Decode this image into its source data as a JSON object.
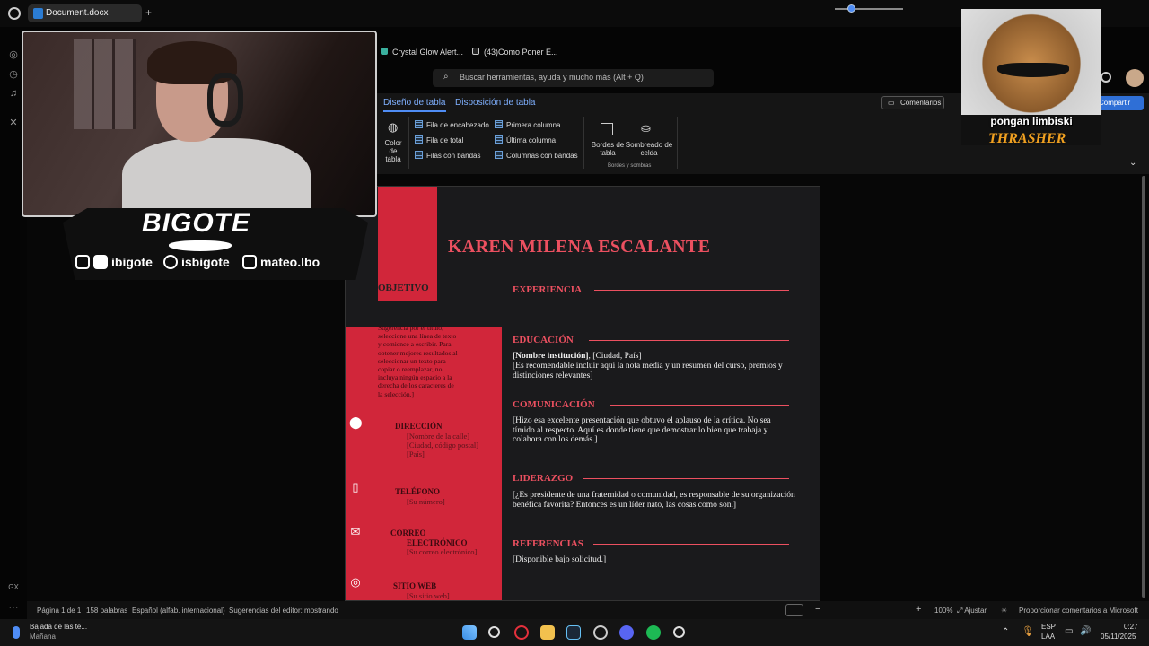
{
  "browser": {
    "tab_title": "Document.docx",
    "new_tab": "+",
    "bookmarks": [
      "Crystal Glow Alert...",
      "(43)Como Poner E..."
    ]
  },
  "word": {
    "search_placeholder": "Buscar herramientas, ayuda y mucho más (Alt + Q)",
    "ribbon_tabs": [
      "Diseño de tabla",
      "Disposición de tabla"
    ],
    "comments_button": "Comentarios",
    "share_button": "Compartir",
    "ribbon": {
      "color_tabla_1": "Color de",
      "color_tabla_2": "tabla",
      "options_col1": [
        "Fila de encabezado",
        "Fila de total",
        "Filas con bandas"
      ],
      "options_col2": [
        "Primera columna",
        "Última columna",
        "Columnas con bandas"
      ],
      "bordes_1": "Bordes de",
      "bordes_2": "tabla",
      "sombreado_1": "Sombreado de",
      "sombreado_2": "celda",
      "group_label": "Bordes y sombras"
    }
  },
  "document": {
    "name": "KAREN MILENA ESCALANTE",
    "objetivo": "OBJETIVO",
    "objetivo_text": "Sugerencia por el título, seleccione una línea de texto y comience a escribir. Para obtener mejores resultados al seleccionar un texto para copiar o reemplazar, no incluya ningún espacio a la derecha de los caracteres de la selección.]",
    "contact": {
      "direccion_head": "DIRECCIÓN",
      "direccion_lines": [
        "[Nombre de la calle]",
        "[Ciudad, código postal]",
        "[País]"
      ],
      "telefono_head": "TELÉFONO",
      "telefono_line": "[Su número]",
      "correo_head_1": "CORREO",
      "correo_head_2": "ELECTRÓNICO",
      "correo_line": "[Su correo electrónico]",
      "web_head": "SITIO WEB",
      "web_line": "[Su sitio web]"
    },
    "sections": {
      "experiencia": "EXPERIENCIA",
      "educacion": "EDUCACIÓN",
      "educacion_bold": "[Nombre institución]",
      "educacion_rest": ", [Ciudad, País]",
      "educacion_body": "[Es recomendable incluir aquí la nota media y un resumen del curso, premios y distinciones relevantes]",
      "comunicacion": "COMUNICACIÓN",
      "comunicacion_body": "[Hizo esa excelente presentación que obtuvo el aplauso de la crítica. No sea tímido al respecto. Aquí es donde tiene que demostrar lo bien que trabaja y colabora con los demás.]",
      "liderazgo": "LIDERAZGO",
      "liderazgo_body": "[¿Es presidente de una fraternidad o comunidad, es responsable de su organización benéfica favorita? Entonces es un líder nato, las cosas como son.]",
      "referencias": "REFERENCIAS",
      "referencias_body": "[Disponible bajo solicitud.]"
    }
  },
  "statusbar": {
    "page": "Página 1 de 1",
    "words": "158 palabras",
    "language": "Español (alfab. internacional)",
    "suggestions": "Sugerencias del editor: mostrando",
    "zoom": "100%",
    "fit": "Ajustar",
    "feedback": "Proporcionar comentarios a Microsoft"
  },
  "taskbar": {
    "weather_title": "Bajada de las te...",
    "weather_sub": "Mañana",
    "lang_1": "ESP",
    "lang_2": "LAA",
    "time": "0:27",
    "date": "05/11/2025"
  },
  "stream_overlay": {
    "brand": "BIGOTE",
    "socials": [
      "ibigote",
      "isbigote",
      "mateo.lbo"
    ],
    "gx": "GX"
  },
  "cat_overlay": {
    "caption": "pongan limbiski",
    "shirt_text": "THRASHER"
  }
}
